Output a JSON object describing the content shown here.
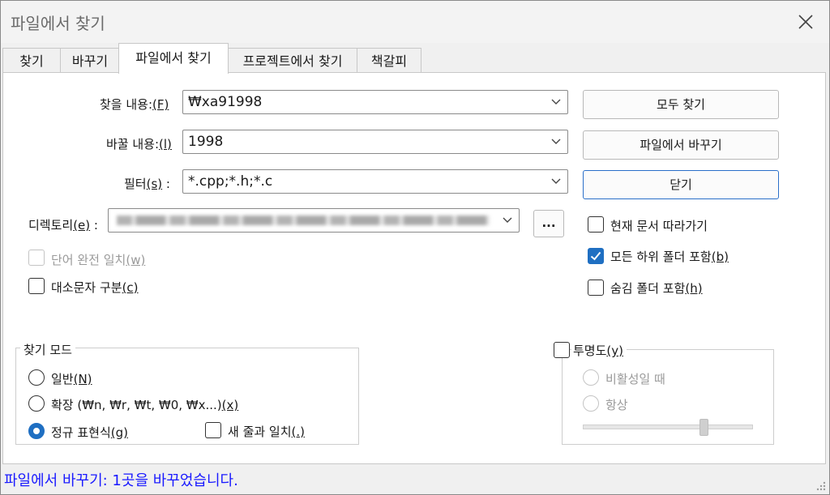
{
  "window": {
    "title": "파일에서 찾기"
  },
  "tabs": [
    {
      "label": "찾기"
    },
    {
      "label": "바꾸기"
    },
    {
      "label": "파일에서 찾기"
    },
    {
      "label": "프로젝트에서 찾기"
    },
    {
      "label": "책갈피"
    }
  ],
  "find": {
    "label": "찾을 내용:",
    "key": "(F)",
    "value": "₩xa91998"
  },
  "replace": {
    "label": "바꿀 내용:",
    "key": "(l)",
    "value": "1998"
  },
  "filter": {
    "label": "필터",
    "key": "(s)",
    "suffix": " :",
    "value": "*.cpp;*.h;*.c"
  },
  "directory": {
    "label": "디렉토리",
    "key": "(e)",
    "suffix": " :",
    "browse": "..."
  },
  "buttons": {
    "find_all": "모두 찾기",
    "replace_in_files": "파일에서 바꾸기",
    "close": "닫기"
  },
  "options": {
    "follow_doc": {
      "label": "현재 문서 따라가기",
      "checked": false
    },
    "subfolders": {
      "label": "모든 하위 폴더 포함",
      "key": "(b)",
      "checked": true
    },
    "hidden": {
      "label": "숨김 폴더 포함",
      "key": "(h)",
      "checked": false
    },
    "whole_word": {
      "label": "단어 완전 일치",
      "key": "(w)",
      "checked": false,
      "disabled": true
    },
    "match_case": {
      "label": "대소문자 구분",
      "key": "(c)",
      "checked": false
    }
  },
  "search_mode": {
    "title": "찾기 모드",
    "normal": {
      "label": "일반",
      "key": "(N)"
    },
    "extended": {
      "label": "확장 (₩n, ₩r, ₩t, ₩0, ₩x...)",
      "key": "(x)"
    },
    "regex": {
      "label": "정규 표현식",
      "key": "(g)",
      "selected": true
    },
    "newline": {
      "label": "새 줄과 일치",
      "key": "(.)"
    }
  },
  "transparency": {
    "label": "투명도",
    "key": "(y)",
    "on_lose_focus": "비활성일 때",
    "always": "항상"
  },
  "status": {
    "text": "파일에서 바꾸기: 1곳을 바꾸었습니다."
  },
  "colors": {
    "accent": "#1f6fc2",
    "status_text": "#1a1aff"
  }
}
